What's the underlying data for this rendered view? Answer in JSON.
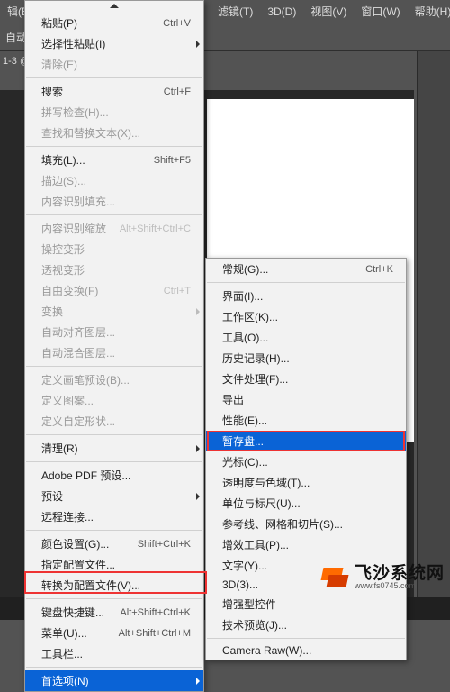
{
  "menubar": {
    "items": [
      {
        "label": "辑(E)"
      },
      {
        "label": "滤镜(T)"
      },
      {
        "label": "3D(D)"
      },
      {
        "label": "视图(V)"
      },
      {
        "label": "窗口(W)"
      },
      {
        "label": "帮助(H)"
      }
    ]
  },
  "toolbar": {
    "mode_label": "自动"
  },
  "edit_menu": {
    "items": [
      {
        "label": "粘贴(P)",
        "shortcut": "Ctrl+V",
        "disabled": false
      },
      {
        "label": "选择性粘贴(I)",
        "disabled": false,
        "submenu": true
      },
      {
        "label": "清除(E)",
        "disabled": true
      },
      {
        "sep": true
      },
      {
        "label": "搜索",
        "shortcut": "Ctrl+F"
      },
      {
        "label": "拼写检查(H)...",
        "disabled": true
      },
      {
        "label": "查找和替换文本(X)...",
        "disabled": true
      },
      {
        "sep": true
      },
      {
        "label": "填充(L)...",
        "shortcut": "Shift+F5"
      },
      {
        "label": "描边(S)...",
        "disabled": true
      },
      {
        "label": "内容识别填充...",
        "disabled": true
      },
      {
        "sep": true
      },
      {
        "label": "内容识别缩放",
        "shortcut": "Alt+Shift+Ctrl+C",
        "disabled": true
      },
      {
        "label": "操控变形",
        "disabled": true
      },
      {
        "label": "透视变形",
        "disabled": true
      },
      {
        "label": "自由变换(F)",
        "shortcut": "Ctrl+T",
        "disabled": true
      },
      {
        "label": "变换",
        "disabled": true,
        "submenu": true
      },
      {
        "label": "自动对齐图层...",
        "disabled": true
      },
      {
        "label": "自动混合图层...",
        "disabled": true
      },
      {
        "sep": true
      },
      {
        "label": "定义画笔预设(B)...",
        "disabled": true
      },
      {
        "label": "定义图案...",
        "disabled": true
      },
      {
        "label": "定义自定形状...",
        "disabled": true
      },
      {
        "sep": true
      },
      {
        "label": "清理(R)",
        "submenu": true
      },
      {
        "sep": true
      },
      {
        "label": "Adobe PDF 预设..."
      },
      {
        "label": "预设",
        "submenu": true
      },
      {
        "label": "远程连接..."
      },
      {
        "sep": true
      },
      {
        "label": "颜色设置(G)...",
        "shortcut": "Shift+Ctrl+K"
      },
      {
        "label": "指定配置文件..."
      },
      {
        "label": "转换为配置文件(V)..."
      },
      {
        "sep": true
      },
      {
        "label": "键盘快捷键...",
        "shortcut": "Alt+Shift+Ctrl+K"
      },
      {
        "label": "菜单(U)...",
        "shortcut": "Alt+Shift+Ctrl+M"
      },
      {
        "label": "工具栏..."
      },
      {
        "sep": true
      },
      {
        "label": "首选项(N)",
        "submenu": true,
        "highlight": true
      }
    ]
  },
  "pref_submenu": {
    "items": [
      {
        "label": "常规(G)...",
        "shortcut": "Ctrl+K"
      },
      {
        "sep": true
      },
      {
        "label": "界面(I)..."
      },
      {
        "label": "工作区(K)..."
      },
      {
        "label": "工具(O)..."
      },
      {
        "label": "历史记录(H)..."
      },
      {
        "label": "文件处理(F)..."
      },
      {
        "label": "导出"
      },
      {
        "label": "性能(E)..."
      },
      {
        "label": "暂存盘...",
        "highlight": true,
        "outline": true
      },
      {
        "label": "光标(C)..."
      },
      {
        "label": "透明度与色域(T)..."
      },
      {
        "label": "单位与标尺(U)..."
      },
      {
        "label": "参考线、网格和切片(S)..."
      },
      {
        "label": "增效工具(P)..."
      },
      {
        "label": "文字(Y)..."
      },
      {
        "label": "3D(3)..."
      },
      {
        "label": "增强型控件"
      },
      {
        "label": "技术预览(J)..."
      },
      {
        "sep": true
      },
      {
        "label": "Camera Raw(W)..."
      }
    ]
  },
  "watermark": {
    "title": "飞沙系统网",
    "url": "www.fs0745.com"
  },
  "doc_tab": {
    "label": "1-3 @"
  }
}
